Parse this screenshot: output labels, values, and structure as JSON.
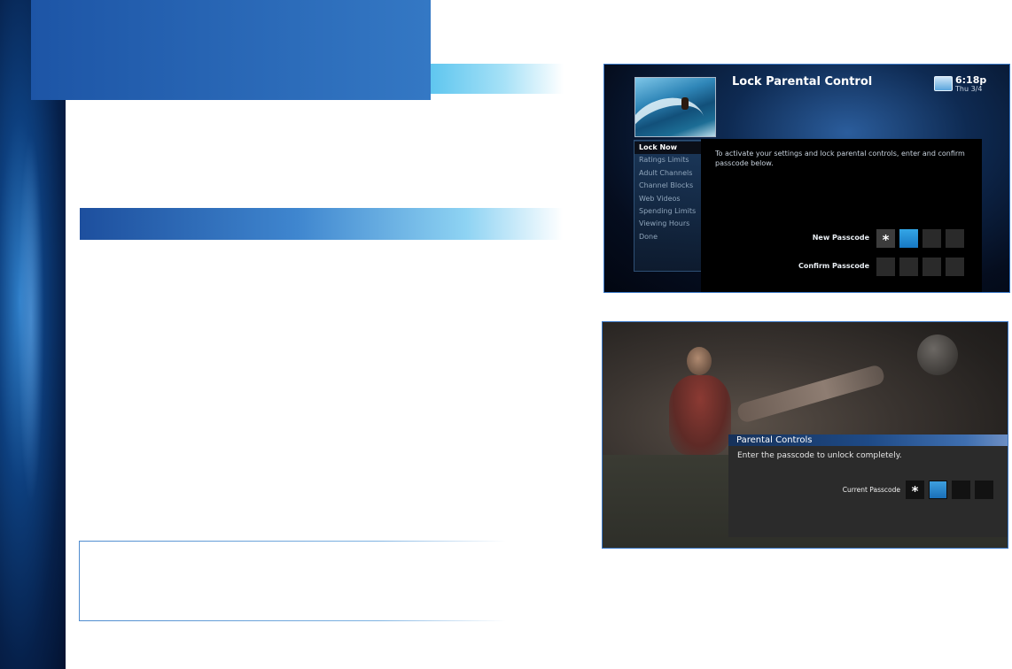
{
  "screen1": {
    "title": "Lock Parental Control",
    "time": "6:18p",
    "date": "Thu 3/4",
    "menu_items": [
      "Lock Now",
      "Ratings Limits",
      "Adult Channels",
      "Channel Blocks",
      "Web Videos",
      "Spending Limits",
      "Viewing Hours",
      "Done"
    ],
    "selected_menu_item": "Lock Now",
    "instruction": "To activate your settings and lock parental controls, enter and confirm passcode below.",
    "new_passcode_label": "New Passcode",
    "confirm_passcode_label": "Confirm Passcode",
    "masked_char": "*",
    "brand_icon": "directv-logo-icon",
    "thumbnail_icon": "surfing-image"
  },
  "screen2": {
    "dialog_title": "Parental Controls",
    "instruction": "Enter the passcode to unlock completely.",
    "current_passcode_label": "Current Passcode",
    "masked_char": "*",
    "background_image": "soccer-player-image"
  },
  "colors": {
    "brand_blue": "#1d55a6",
    "accent_cyan": "#5fc6ef",
    "active_box": "#1778c4"
  }
}
